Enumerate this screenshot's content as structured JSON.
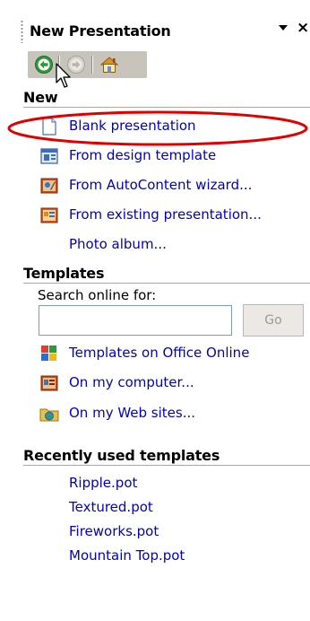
{
  "task_pane": {
    "title": "New Presentation",
    "dropdown_icon": "triangle-down-icon",
    "close_label": "×"
  },
  "toolbar": {
    "back_icon": "back-arrow-icon",
    "forward_icon": "forward-arrow-icon",
    "home_icon": "home-icon"
  },
  "new_section": {
    "heading": "New",
    "items": [
      {
        "label": "Blank presentation",
        "icon": "blank-document-icon"
      },
      {
        "label": "From design template",
        "icon": "design-template-icon"
      },
      {
        "label": "From AutoContent wizard...",
        "icon": "autocontent-wizard-icon"
      },
      {
        "label": "From existing presentation...",
        "icon": "existing-presentation-icon"
      },
      {
        "label": "Photo album...",
        "icon": ""
      }
    ]
  },
  "templates_section": {
    "heading": "Templates",
    "search_label": "Search online for:",
    "search_value": "",
    "go_label": "Go",
    "items": [
      {
        "label": "Templates on Office Online",
        "icon": "office-online-icon"
      },
      {
        "label": "On my computer...",
        "icon": "my-computer-templates-icon"
      },
      {
        "label": "On my Web sites...",
        "icon": "web-sites-icon"
      }
    ]
  },
  "recent_section": {
    "heading": "Recently used templates",
    "items": [
      {
        "label": "Ripple.pot"
      },
      {
        "label": "Textured.pot"
      },
      {
        "label": "Fireworks.pot"
      },
      {
        "label": "Mountain Top.pot"
      }
    ]
  },
  "colors": {
    "link": "#0000c8",
    "highlight_ellipse": "#e00000",
    "toolbar_bg": "#c8c4bc"
  }
}
